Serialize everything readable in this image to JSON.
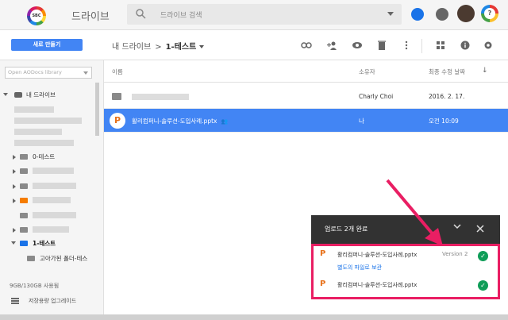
{
  "header": {
    "logo_text": "SBC",
    "app_title": "드라이브",
    "search_placeholder": "드라이브 검색",
    "account_initial": "?"
  },
  "toolbar": {
    "new_label": "새로 만들기",
    "breadcrumb_root": "내 드라이브",
    "breadcrumb_sep": ">",
    "breadcrumb_current": "1-테스트",
    "icons": [
      "link-icon",
      "add-person-icon",
      "preview-icon",
      "trash-icon",
      "more-icon",
      "grid-view-icon",
      "info-icon",
      "settings-icon"
    ]
  },
  "sidebar": {
    "library_placeholder": "Open AODocs library",
    "root_label": "내 드라이브",
    "items": [
      {
        "label": "0-테스트",
        "folder_color": "#8a8a8a"
      },
      {
        "label": "1-테스트",
        "folder_color": "#1a73e8"
      },
      {
        "label": "고아가된 폴더-테스",
        "folder_color": "#8a8a8a"
      }
    ],
    "storage": "9GB/130GB 사용됨",
    "upgrade": "저장용량 업그레이드"
  },
  "list": {
    "headers": {
      "name": "이름",
      "owner": "소유자",
      "modified": "최종 수정 날짜"
    },
    "rows": [
      {
        "name": "",
        "owner": "Charly Choi",
        "modified": "2016. 2. 17.",
        "selected": false
      },
      {
        "name": "활리컴퍼니-솔루션-도입사례.pptx",
        "owner": "나",
        "modified": "오전 10:09",
        "selected": true
      }
    ]
  },
  "upload": {
    "title": "업로드 2개 완료",
    "items": [
      {
        "name": "활리컴퍼니-솔루션-도입사례.pptx",
        "version": "Version 2",
        "link": "별도의 파일로 보관"
      },
      {
        "name": "활리컴퍼니-솔루션-도입사례.pptx",
        "version": "",
        "link": ""
      }
    ]
  },
  "colors": {
    "accent": "#4285f4",
    "annotation": "#e91e63",
    "success": "#0f9d58",
    "pptx": "#e8711a"
  }
}
